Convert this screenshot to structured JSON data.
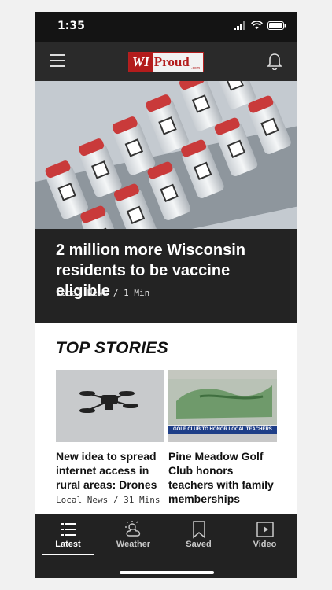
{
  "status": {
    "time": "1:35"
  },
  "header": {
    "logo_text_wi": "WI",
    "logo_text_proud": "Proud",
    "logo_text_com": ".com",
    "menu_icon": "hamburger-icon",
    "notification_icon": "bell-icon"
  },
  "hero": {
    "title": "2 million more Wisconsin residents to be vaccine eligible",
    "meta": "Local News / 1 Min"
  },
  "top_stories": {
    "title": "TOP STORIES",
    "items": [
      {
        "title": "New idea to spread internet access in rural areas: Drones",
        "meta": "Local News / 31 Mins"
      },
      {
        "title": "Pine Meadow Golf Club honors teachers with family memberships",
        "meta": "",
        "thumb_caption": "GOLF CLUB TO HONOR LOCAL TEACHERS"
      }
    ]
  },
  "tabs": [
    {
      "label": "Latest",
      "icon": "list-icon",
      "active": true
    },
    {
      "label": "Weather",
      "icon": "weather-icon",
      "active": false
    },
    {
      "label": "Saved",
      "icon": "bookmark-icon",
      "active": false
    },
    {
      "label": "Video",
      "icon": "video-icon",
      "active": false
    }
  ],
  "colors": {
    "brand_red": "#b31c1c",
    "bar_dark": "#222222"
  }
}
